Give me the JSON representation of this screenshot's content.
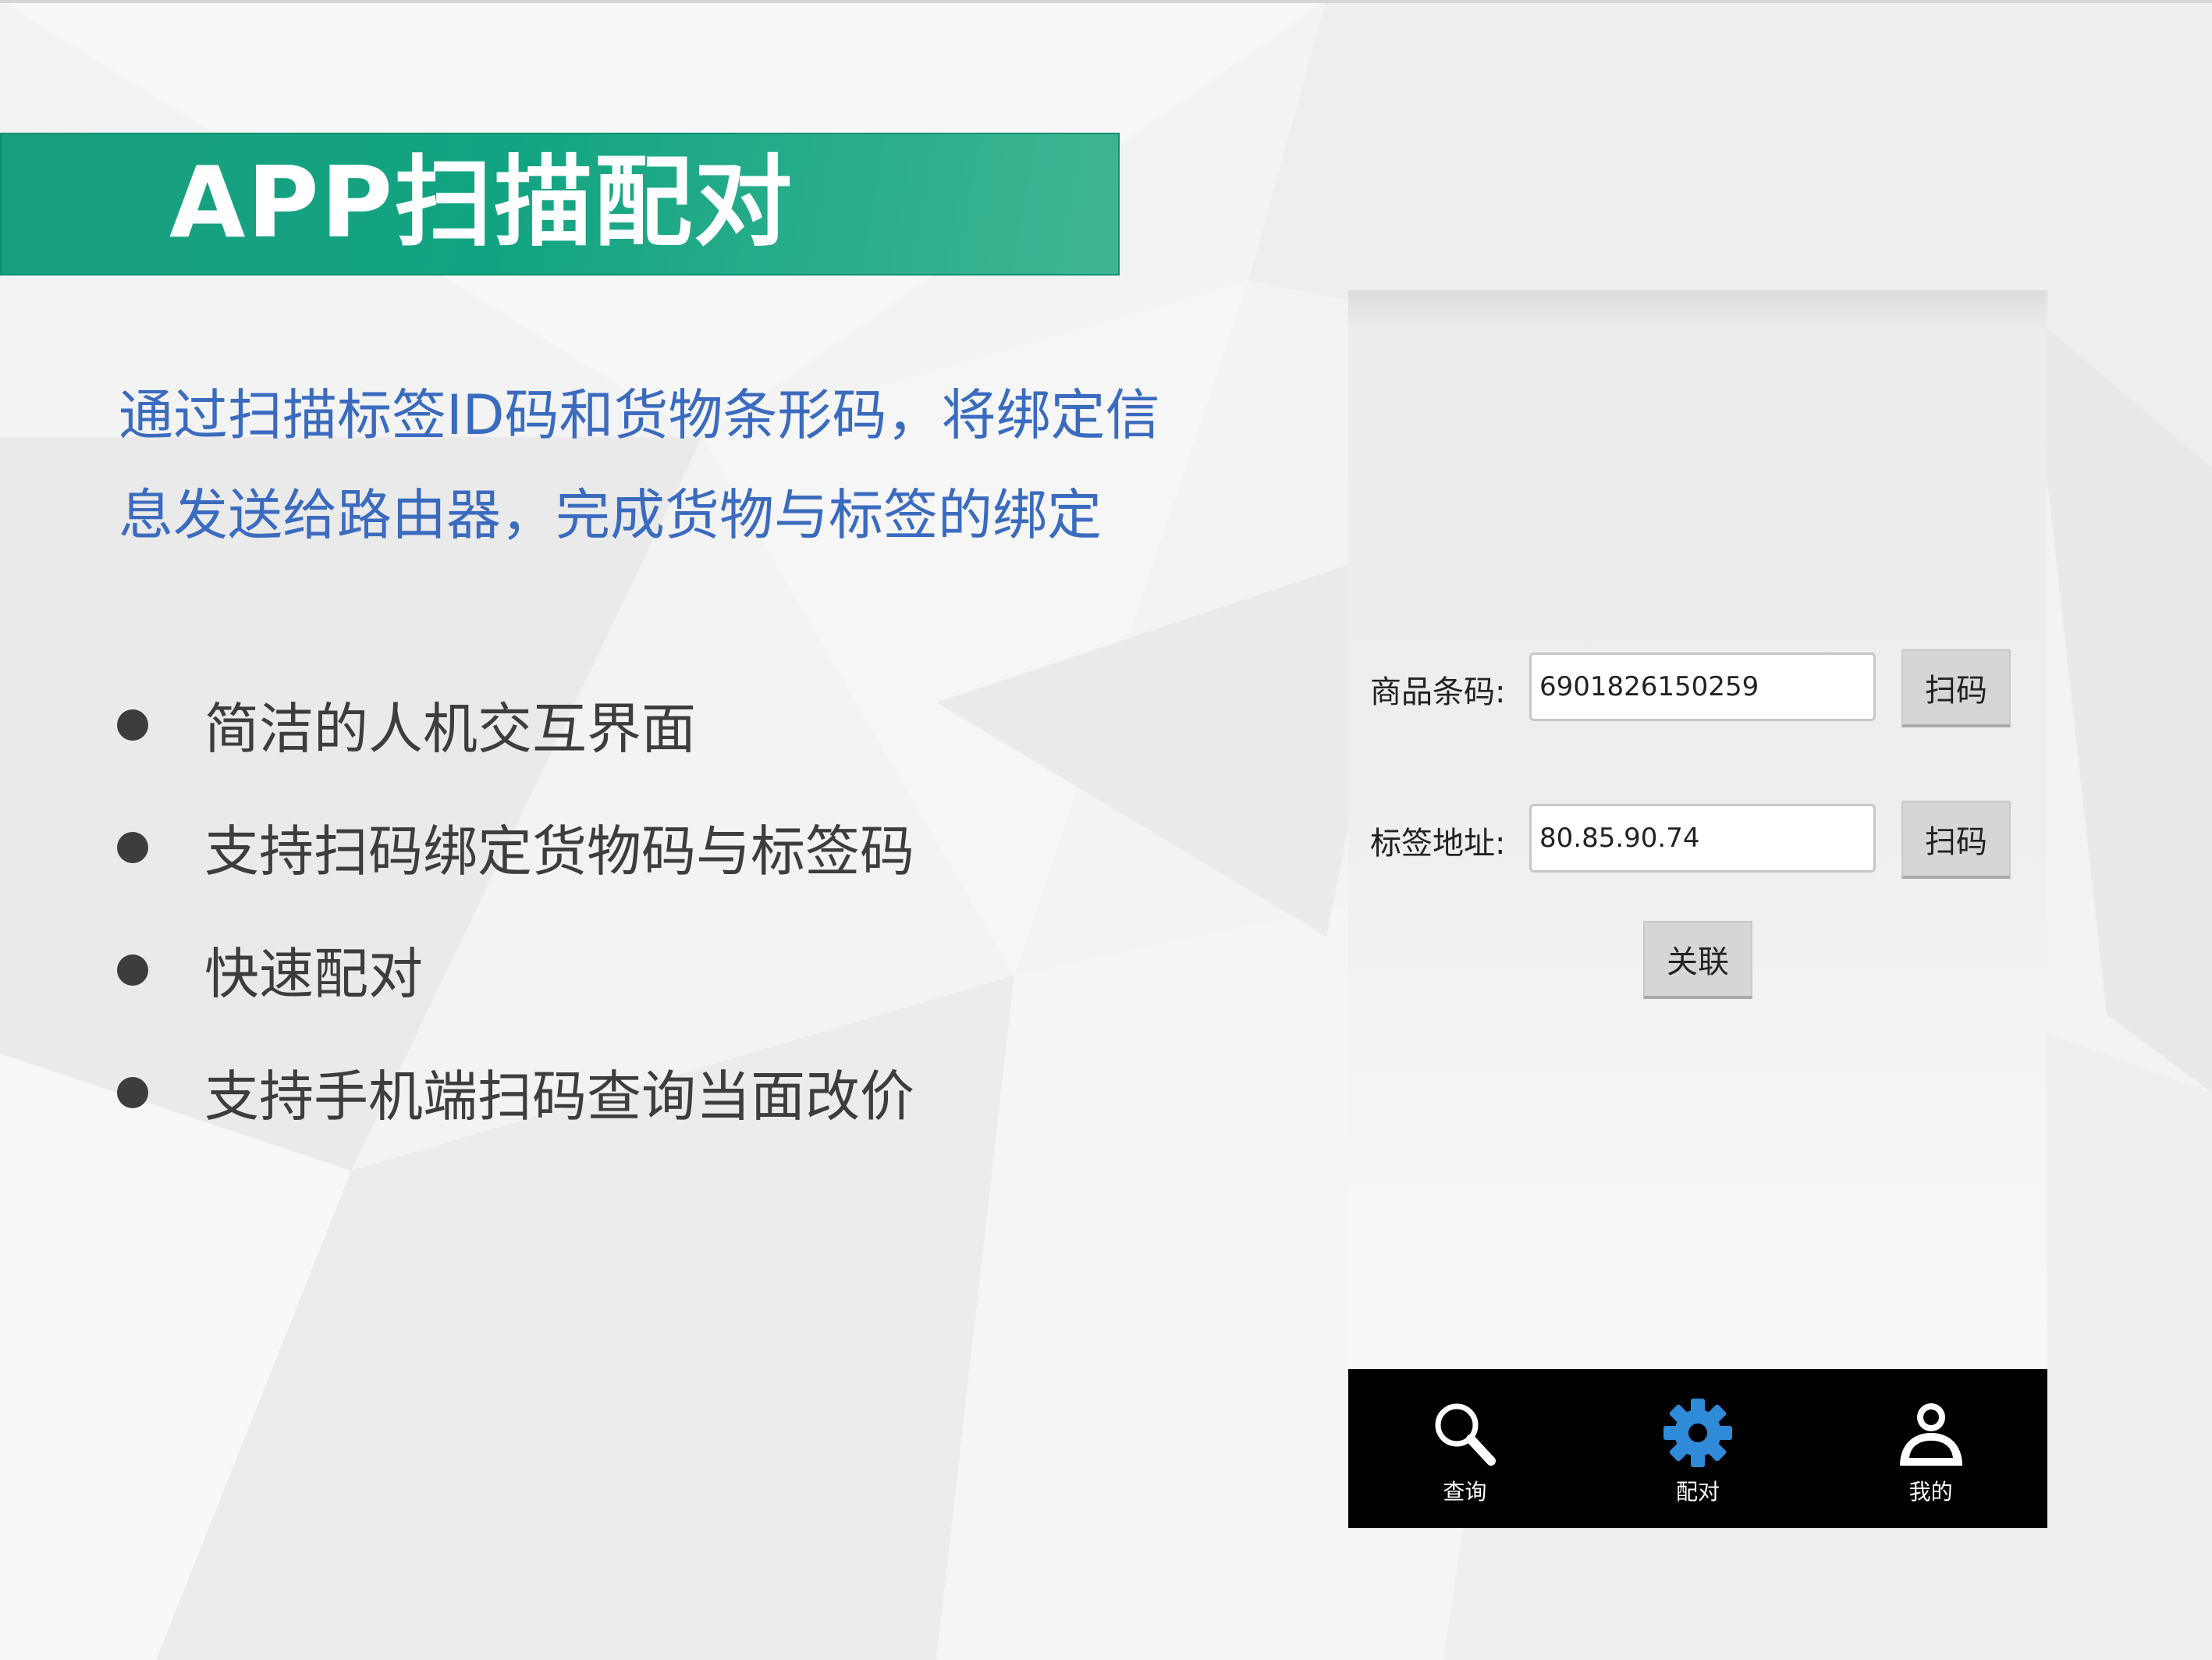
{
  "slide": {
    "title": "APP扫描配对",
    "description_lines": [
      "通过扫描标签ID码和货物条形码，将绑定信",
      "息发送给路由器，完成货物与标签的绑定"
    ],
    "bullets": [
      "简洁的人机交互界面",
      "支持扫码绑定货物码与标签码",
      "快速配对",
      "支持手机端扫码查询当面改价"
    ]
  },
  "app": {
    "barcode": {
      "label": "商品条码:",
      "value": "6901826150259",
      "scan_label": "扫码"
    },
    "tag_address": {
      "label": "标签地址:",
      "value": "80.85.90.74",
      "scan_label": "扫码"
    },
    "link_label": "关联",
    "nav": [
      {
        "label": "查询",
        "icon": "search-icon"
      },
      {
        "label": "配对",
        "icon": "gear-icon"
      },
      {
        "label": "我的",
        "icon": "user-icon"
      }
    ]
  },
  "colors": {
    "banner": "#12a482",
    "description_text": "#3a6bbf",
    "bullet_text": "#3d3d3d",
    "nav_background": "#000000",
    "active_nav_icon": "#2f8ad8"
  }
}
